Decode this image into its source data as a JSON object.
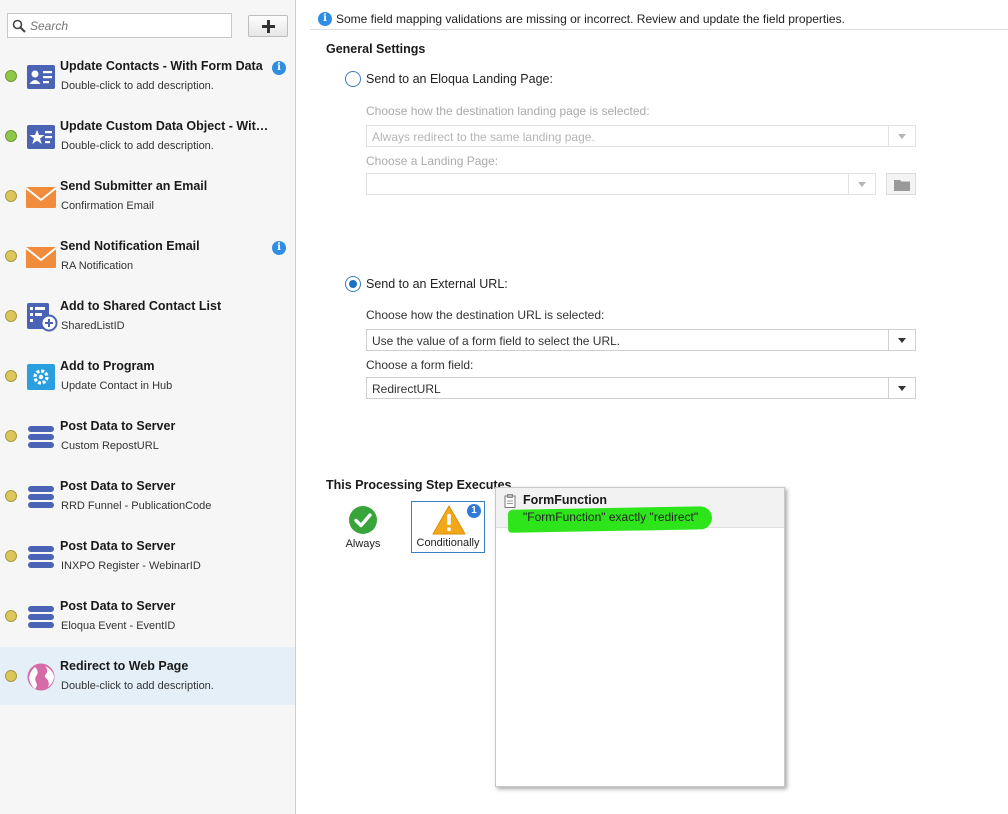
{
  "sidebar": {
    "search_placeholder": "Search",
    "steps": [
      {
        "title": "Update Contacts - With Form Data",
        "desc": "Double-click to add description.",
        "status": "green",
        "icon": "contact-card-icon",
        "info": true
      },
      {
        "title": "Update Custom Data Object - With ...",
        "desc": "Double-click to add description.",
        "status": "green",
        "icon": "custom-object-icon",
        "info": false
      },
      {
        "title": "Send Submitter an Email",
        "desc": "Confirmation Email",
        "status": "yellow",
        "icon": "envelope-icon",
        "info": false
      },
      {
        "title": "Send Notification Email",
        "desc": "RA Notification",
        "status": "yellow",
        "icon": "envelope-icon",
        "info": true
      },
      {
        "title": "Add to Shared Contact List",
        "desc": "SharedListID",
        "status": "yellow",
        "icon": "shared-list-icon",
        "info": false
      },
      {
        "title": "Add to Program",
        "desc": "Update Contact in Hub",
        "status": "yellow",
        "icon": "program-gear-icon",
        "info": false
      },
      {
        "title": "Post Data to Server",
        "desc": "Custom RepostURL",
        "status": "yellow",
        "icon": "database-icon",
        "info": false
      },
      {
        "title": "Post Data to Server",
        "desc": "RRD Funnel - PublicationCode",
        "status": "yellow",
        "icon": "database-icon",
        "info": false
      },
      {
        "title": "Post Data to Server",
        "desc": "INXPO Register - WebinarID",
        "status": "yellow",
        "icon": "database-icon",
        "info": false
      },
      {
        "title": "Post Data to Server",
        "desc": "Eloqua Event - EventID",
        "status": "yellow",
        "icon": "database-icon",
        "info": false
      },
      {
        "title": "Redirect to Web Page",
        "desc": "Double-click to add description.",
        "status": "yellow",
        "icon": "globe-icon",
        "info": false,
        "selected": true
      }
    ]
  },
  "alert": {
    "message": "Some field mapping validations are missing or incorrect. Review and update the field properties."
  },
  "main": {
    "general_settings": "General Settings",
    "landing": {
      "radio_label": "Send to an Eloqua Landing Page:",
      "how_label": "Choose how the destination landing page is selected:",
      "how_value": "Always redirect to the same landing page.",
      "page_label": "Choose a Landing Page:",
      "page_value": ""
    },
    "external": {
      "radio_label": "Send to an External URL:",
      "how_label": "Choose how the destination URL is selected:",
      "how_value": "Use the value of a form field to select the URL.",
      "field_label": "Choose a form field:",
      "field_value": "RedirectURL"
    },
    "executes_title": "This Processing Step Executes",
    "always_label": "Always",
    "conditionally_label": "Conditionally",
    "condition_count": "1",
    "popup": {
      "field_name": "FormFunction",
      "condition": "\"FormFunction\" exactly \"redirect\""
    }
  }
}
